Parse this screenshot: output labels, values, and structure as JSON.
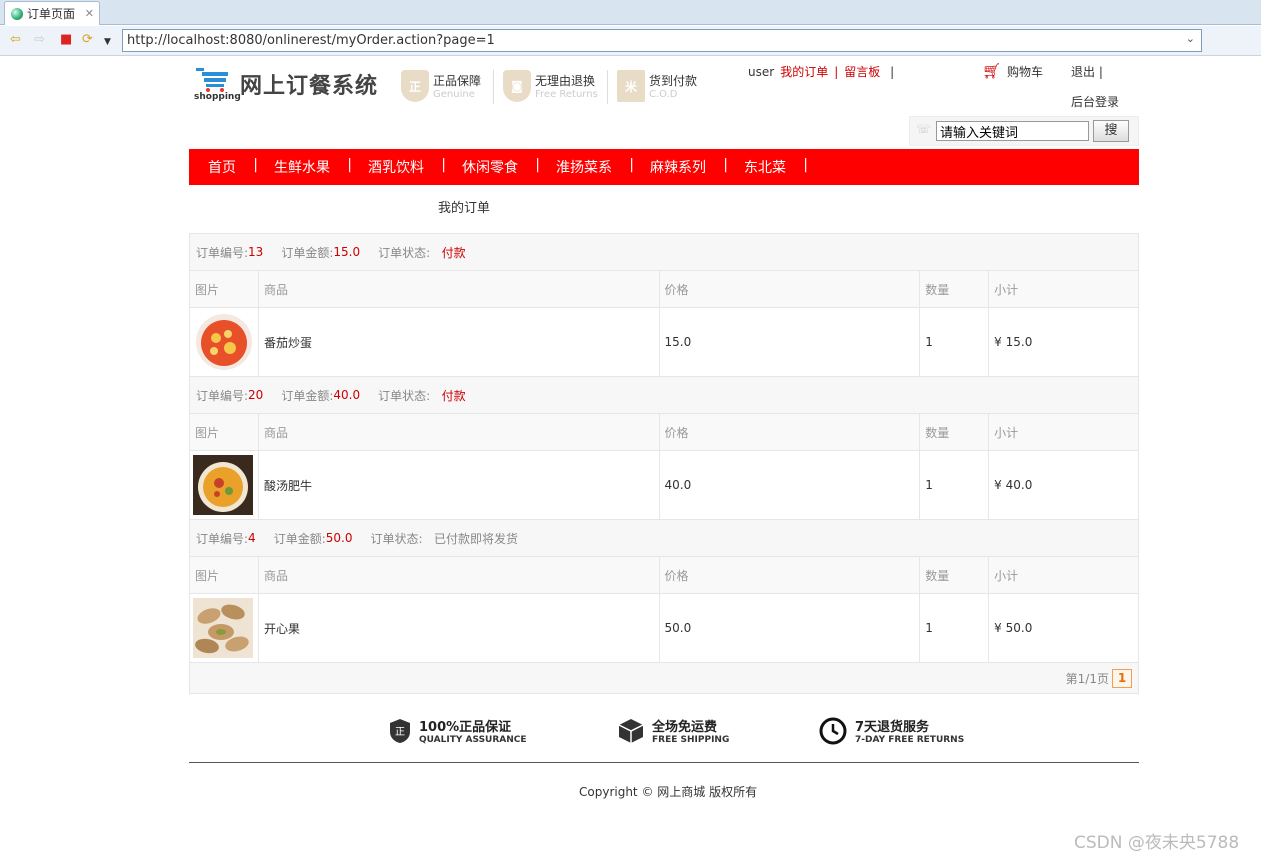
{
  "browser": {
    "tab_title": "订单页面",
    "url": "http://localhost:8080/onlinerest/myOrder.action?page=1"
  },
  "header": {
    "logo_text": "网上订餐系统",
    "logo_sub": "shopping",
    "badges": [
      {
        "title": "正品保障",
        "sub": "Genuine",
        "icon": "正"
      },
      {
        "title": "无理由退换",
        "sub": "Free Returns",
        "icon": "◙"
      },
      {
        "title": "货到付款",
        "sub": "C.O.D",
        "icon": "米"
      }
    ],
    "user": "user",
    "my_orders": "我的订单",
    "message_board": "留言板",
    "cart": "购物车",
    "logout": "退出",
    "admin_login": "后台登录",
    "search_value": "请输入关键词",
    "search_button": "搜"
  },
  "nav": [
    "首页",
    "生鲜水果",
    "酒乳饮料",
    "休闲零食",
    "淮扬菜系",
    "麻辣系列",
    "东北菜"
  ],
  "page_title": "我的订单",
  "labels": {
    "order_no": "订单编号:",
    "order_amount": "订单金额:",
    "order_status": "订单状态:",
    "col_image": "图片",
    "col_product": "商品",
    "col_price": "价格",
    "col_qty": "数量",
    "col_subtotal": "小计"
  },
  "orders": [
    {
      "no": "13",
      "amount": "15.0",
      "status": "付款",
      "product": "番茄炒蛋",
      "price": "15.0",
      "qty": "1",
      "subtotal": "¥ 15.0"
    },
    {
      "no": "20",
      "amount": "40.0",
      "status": "付款",
      "product": "酸汤肥牛",
      "price": "40.0",
      "qty": "1",
      "subtotal": "¥ 40.0"
    },
    {
      "no": "4",
      "amount": "50.0",
      "status": "已付款即将发货",
      "product": "开心果",
      "price": "50.0",
      "qty": "1",
      "subtotal": "¥ 50.0"
    }
  ],
  "pager": {
    "text": "第1/1页",
    "current": "1"
  },
  "footer": {
    "features": [
      {
        "title": "100%正品保证",
        "sub": "QUALITY ASSURANCE"
      },
      {
        "title": "全场免运费",
        "sub": "FREE SHIPPING"
      },
      {
        "title": "7天退货服务",
        "sub": "7-DAY FREE RETURNS"
      }
    ],
    "copyright": "Copyright © 网上商城 版权所有"
  },
  "watermark": "CSDN @夜未央5788",
  "colors": {
    "nav": "#ff0000",
    "accent_red": "#cc0000"
  }
}
